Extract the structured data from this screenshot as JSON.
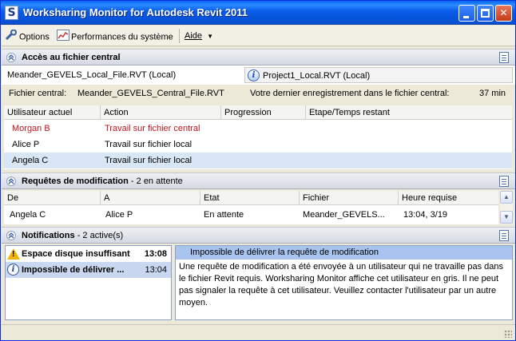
{
  "window": {
    "title": "Worksharing Monitor for Autodesk Revit 2011",
    "icon_letter": "S",
    "controls": [
      "minimize-icon",
      "maximize-icon",
      "close-icon"
    ]
  },
  "toolbar": {
    "options_label": "Options",
    "performance_label": "Performances du système",
    "help_label": "Aide",
    "help_underline_char": "A"
  },
  "central_access": {
    "title": "Accès au fichier central",
    "tabs": [
      {
        "label": "Meander_GEVELS_Local_File.RVT (Local)"
      },
      {
        "label": "Project1_Local.RVT (Local)"
      }
    ],
    "central_file_label": "Fichier central:",
    "central_file_value": "Meander_GEVELS_Central_File.RVT",
    "last_save_label": "Votre dernier enregistrement dans le fichier central:",
    "last_save_value": "37 min",
    "columns": [
      "Utilisateur actuel",
      "Action",
      "Progression",
      "Etape/Temps restant"
    ],
    "rows": [
      {
        "user": "Morgan B",
        "action": "Travail sur fichier central",
        "progress": "",
        "step": "",
        "status_color": "#c0141c"
      },
      {
        "user": "Alice P",
        "action": "Travail sur fichier local",
        "progress": "",
        "step": ""
      },
      {
        "user": "Angela C",
        "action": "Travail sur fichier local",
        "progress": "",
        "step": ""
      }
    ]
  },
  "requests": {
    "title": "Requêtes de modification",
    "count": "- 2 en attente",
    "columns": [
      "De",
      "A",
      "Etat",
      "Fichier",
      "Heure requise"
    ],
    "rows": [
      {
        "from": "Angela C",
        "to": "Alice P",
        "state": "En attente",
        "file": "Meander_GEVELS...",
        "time": "13:04, 3/19"
      }
    ]
  },
  "notifications": {
    "title": "Notifications",
    "count": "- 2 active(s)",
    "items": [
      {
        "icon": "warning-icon",
        "label": "Espace disque insuffisant",
        "time": "13:08"
      },
      {
        "icon": "info-icon",
        "label": "Impossible de délivrer ...",
        "time": "13:04"
      }
    ],
    "detail_title": "Impossible de délivrer la requête de modification",
    "detail_body": "Une requête de modification a été envoyée à un utilisateur qui ne travaille pas dans le fichier Revit requis. Worksharing Monitor affiche cet utilisateur en gris. Il ne peut pas signaler la requête à cet utilisateur. Veuillez contacter l'utilisateur par un autre moyen."
  }
}
